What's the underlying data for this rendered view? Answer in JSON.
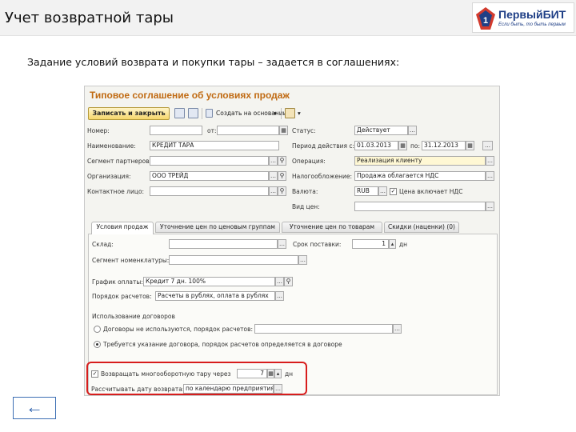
{
  "slide": {
    "title": "Учет возвратной тары",
    "subtitle": "Задание условий возврата и покупки тары – задается в соглашениях:"
  },
  "logo": {
    "name": "ПервыйБИТ",
    "slogan": "Если быть, то быть первым"
  },
  "form": {
    "title": "Типовое соглашение об условиях продаж",
    "toolbar": {
      "save_close": "Записать и закрыть",
      "create_based_on": "Создать на основании",
      "dropdown_arrow": "▾"
    },
    "fields": {
      "number_label": "Номер:",
      "number_value": "",
      "from_label": "от:",
      "from_value": "",
      "status_label": "Статус:",
      "status_value": "Действует",
      "name_label": "Наименование:",
      "name_value": "КРЕДИТ ТАРА",
      "period_label": "Период действия с:",
      "period_from": "01.03.2013",
      "period_to_label": "по:",
      "period_to": "31.12.2013",
      "segment_label": "Сегмент партнеров:",
      "segment_value": "",
      "operation_label": "Операция:",
      "operation_value": "Реализация клиенту",
      "org_label": "Организация:",
      "org_value": "ООО ТРЕЙД",
      "tax_label": "Налогообложение:",
      "tax_value": "Продажа облагается НДС",
      "contact_label": "Контактное лицо:",
      "contact_value": "",
      "currency_label": "Валюта:",
      "currency_value": "RUB",
      "price_includes_vat": "Цена включает НДС",
      "price_type_label": "Вид цен:",
      "price_type_value": ""
    },
    "tabs": [
      {
        "label": "Условия продаж"
      },
      {
        "label": "Уточнение цен по ценовым группам"
      },
      {
        "label": "Уточнение цен по товарам"
      },
      {
        "label": "Скидки (наценки) (0)"
      }
    ],
    "panel": {
      "warehouse_label": "Склад:",
      "warehouse_value": "",
      "delivery_label": "Срок поставки:",
      "delivery_value": "1",
      "delivery_unit": "дн",
      "nomenclature_segment_label": "Сегмент номенклатуры:",
      "nomenclature_segment_value": "",
      "payment_schedule_label": "График оплаты:",
      "payment_schedule_value": "Кредит 7 дн. 100%",
      "settlement_label": "Порядок расчетов:",
      "settlement_value": "Расчеты в рублях, оплата в рублях",
      "contracts_header": "Использование договоров",
      "contracts_option1": "Договоры не используются, порядок расчетов:",
      "contracts_option1_value": "",
      "contracts_option2": "Требуется указание договора, порядок расчетов определяется в договоре",
      "returnable_label": "Возвращать многооборотную тару через",
      "returnable_days": "7",
      "returnable_unit": "дн",
      "return_date_label": "Рассчитывать дату возврата:",
      "return_date_value": "по календарю предприятия"
    }
  },
  "nav": {
    "back_icon": "←"
  },
  "colors": {
    "form_title": "#c06a12",
    "highlight": "#d71d1d",
    "logo_blue": "#1f3f86",
    "back_blue": "#2f62ad"
  }
}
